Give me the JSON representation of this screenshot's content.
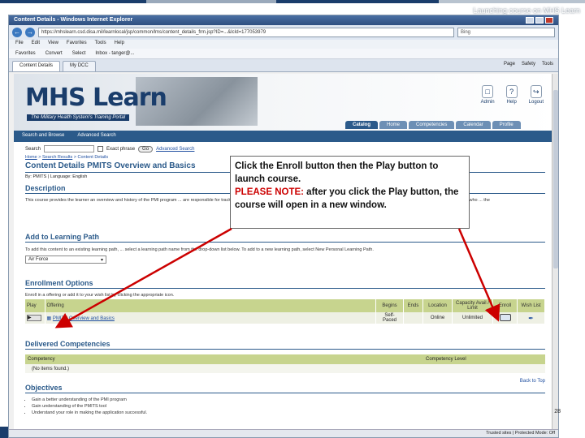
{
  "slide": {
    "caption": "Launching course on MHS Learn",
    "page_number": "28",
    "colors": {
      "navy": "#1a3d6b",
      "accent_red": "#cc0000"
    }
  },
  "browser": {
    "title": "Content Details - Windows Internet Explorer",
    "url": "https://mhslearn.csd.disa.mil/learnlocal/jsp/common/lms/content_details_frm.jsp?ID=...&lcId=177053979",
    "search_placeholder": "Bing",
    "menu": [
      "File",
      "Edit",
      "View",
      "Favorites",
      "Tools",
      "Help"
    ],
    "favorites": [
      "Favorites",
      "Convert",
      "Select",
      "Inbox - tanger@..."
    ],
    "tabs": [
      {
        "label": "Content Details",
        "active": true
      },
      {
        "label": "My DCC",
        "active": false
      }
    ],
    "commands": [
      "Page",
      "Safety",
      "Tools"
    ],
    "status": "Trusted sites | Protected Mode: Off"
  },
  "site": {
    "logo": "MHS Learn",
    "tagline": "The Military Health System's Training Portal",
    "top_links": [
      {
        "label": "Admin",
        "icon": "admin-icon"
      },
      {
        "label": "Help",
        "icon": "help-icon"
      },
      {
        "label": "Logout",
        "icon": "logout-icon"
      }
    ],
    "tabs": [
      {
        "label": "Catalog",
        "active": true
      },
      {
        "label": "Home",
        "active": false
      },
      {
        "label": "Competencies",
        "active": false
      },
      {
        "label": "Calendar",
        "active": false
      },
      {
        "label": "Profile",
        "active": false
      }
    ],
    "subnav": [
      "Search and Browse",
      "Advanced Search"
    ]
  },
  "search": {
    "label": "Search",
    "exact_phrase": "Exact phrase",
    "go": "Go",
    "advanced": "Advanced Search"
  },
  "breadcrumb": [
    "Home",
    "Search Results",
    "Content Details"
  ],
  "page": {
    "title_prefix": "Content Details",
    "title": "PMITS Overview and Basics",
    "byline": "By: PMITS | Language: English",
    "description_heading": "Description",
    "description": "This course provides the learner an overview and history of the PMI program ... are responsible for tracking equipment worldwide. Finally the training provi... deployable bag, and operational procedures.",
    "description_tail": "... Teams and Centers who ... the",
    "learning_path_heading": "Add to Learning Path",
    "learning_path_text": "To add this content to an existing learning path, ... select a learning path name from the drop-down list below. To add to a new learning path, select New Personal Learning Path.",
    "learning_path_selected": "Air Force",
    "enrollment_heading": "Enrollment Options",
    "enrollment_text": "Enroll in a offering or add it to your wish list by clicking the appropriate icon.",
    "competencies_heading": "Delivered Competencies",
    "back_to_top": "Back to Top",
    "objectives_heading": "Objectives",
    "objectives": [
      "Gain a better understanding of the PMI program",
      "Gain understanding of the PMITS tool",
      "Understand your role in making the application successful."
    ]
  },
  "enrollment_table": {
    "headers": [
      "Play",
      "Offering",
      "Begins",
      "Ends",
      "Location",
      "Capacity Avail / Limit",
      "Enroll",
      "Wish List"
    ],
    "rows": [
      {
        "play": "▶",
        "offering": "PMITS Overview and Basics",
        "begins": "Self-Paced",
        "ends": "",
        "location": "Online",
        "capacity": "Unlimited"
      }
    ]
  },
  "competency_table": {
    "headers": [
      "Competency",
      "Competency Level"
    ],
    "empty": "(No items found.)"
  },
  "callout": {
    "line1": "Click the Enroll button then the Play button to launch course.",
    "note_label": "PLEASE NOTE:",
    "note_text": " after you click the Play button, the course will open in a new window."
  }
}
